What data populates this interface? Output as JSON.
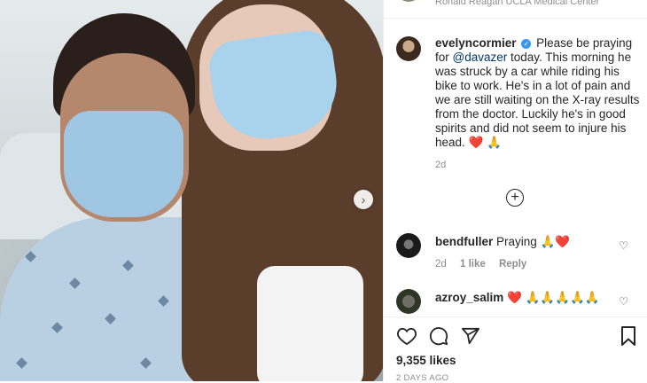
{
  "post": {
    "location": "Ronald Reagan UCLA Medical Center",
    "author": "evelyncormier",
    "caption_before_mention": "Please be praying for ",
    "mention": "@davazer",
    "caption_after_mention": " today. This morning he was struck by a car while riding his bike to work. He's in a lot of pain and we are still waiting on the X-ray results from the doctor. Luckily he's in good spirits and did not seem to injure his head. ",
    "caption_emoji": "❤️ 🙏",
    "caption_time": "2d"
  },
  "comments": [
    {
      "username": "bendfuller",
      "text": "Praying 🙏❤️",
      "time": "2d",
      "likes": "1 like",
      "reply": "Reply"
    },
    {
      "username": "azroy_salim",
      "text": "❤️ 🙏🙏🙏🙏🙏"
    }
  ],
  "engagement": {
    "likes": "9,355 likes",
    "date": "2 DAYS AGO"
  },
  "icons": {
    "verified": "verified-badge-icon",
    "load_more": "plus-circle-icon",
    "next": "chevron-right-icon",
    "like": "heart-icon",
    "comment": "comment-icon",
    "share": "paper-plane-icon",
    "save": "bookmark-icon"
  },
  "colors": {
    "verified": "#3897f0",
    "mention": "#00376b",
    "secondary_text": "#8e8e8e",
    "heart": "#ed4956"
  }
}
